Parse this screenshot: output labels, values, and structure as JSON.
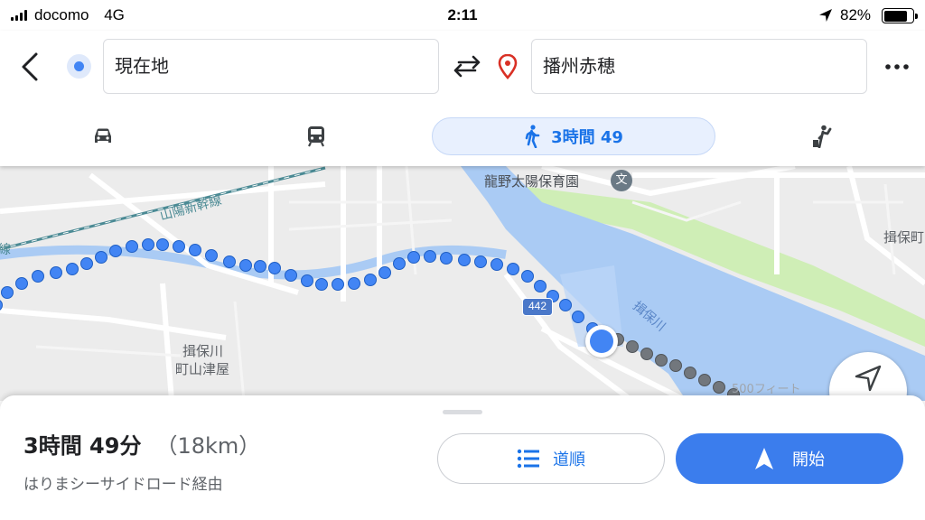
{
  "status_bar": {
    "carrier": "docomo",
    "network": "4G",
    "time": "2:11",
    "battery_percent": "82%",
    "battery_level": 0.82
  },
  "search": {
    "origin": "現在地",
    "destination": "播州赤穂"
  },
  "modes": {
    "car": {
      "icon": "car-icon"
    },
    "transit": {
      "icon": "train-icon"
    },
    "walking": {
      "icon": "walk-icon",
      "label": "3時間 49"
    },
    "ride": {
      "icon": "ride-hail-icon"
    }
  },
  "map": {
    "labels": {
      "shinkansen": "山陽新幹線",
      "shinkansen_edge": "線",
      "school": "龍野太陽保育園",
      "river": "揖保川",
      "town_line1": "揖保川",
      "town_line2": "町山津屋",
      "area_right": "揖保町",
      "route_number": "442",
      "scale": "500フィート"
    },
    "colors": {
      "route": "#4285f4",
      "route_remaining": "#72777d",
      "water": "#aacbf4",
      "park": "#cfeeb6"
    }
  },
  "sheet": {
    "duration": "3時間 49分",
    "distance": "（18km）",
    "via": "はりまシーサイドロード経由",
    "steps_label": "道順",
    "start_label": "開始"
  }
}
